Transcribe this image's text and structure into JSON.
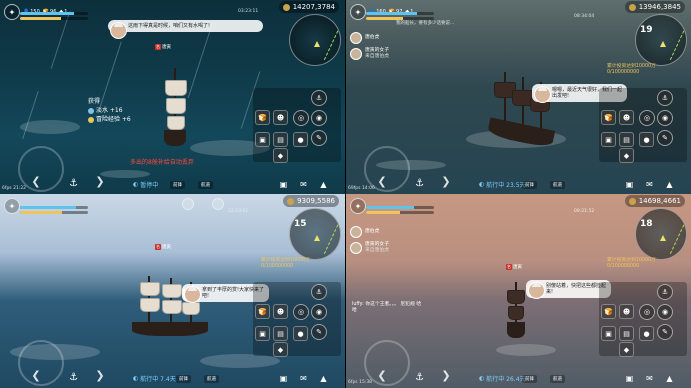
{
  "quadrants": [
    {
      "top": {
        "stat1": "150",
        "stat2": "96",
        "stat3": "1",
        "clock": "03:23:11",
        "gold": "14207,3784"
      },
      "dialog": "这雨下得真是时候，咱们又有水喝了!",
      "nametag": "唐寅",
      "gain": {
        "title": "获得",
        "item1": "淡水 +16",
        "item2": "冒险经验 +6"
      },
      "warning": "多出的8舱补给自动丢弃",
      "bottom": {
        "fps": "6fps 21:22",
        "status": "暂停中",
        "btn1": "前锋",
        "btn2": "航道"
      }
    },
    {
      "top": {
        "stat1": "160",
        "stat2": "97",
        "stat3": "1",
        "clock": "08:34:04",
        "gold": "13946,3845"
      },
      "dialog_top": "我的船长，要有多少话要说...",
      "chat": [
        {
          "name": "唐伯虎",
          "text": "..."
        },
        {
          "name": "唐寅的女子",
          "text": "来自唐伯虎"
        }
      ],
      "cargo": "累计投资达到10000万0/100000000",
      "dialog": "嗯嗯，最近天气很好，我们一起出发吧!",
      "minimap_num": "19",
      "bottom": {
        "fps": "69fps 14:06",
        "status": "航行中 23.5天",
        "btn1": "前锋",
        "btn2": "航道"
      }
    },
    {
      "top": {
        "stat1": "",
        "stat2": "",
        "stat3": "",
        "clock": "22:23:01",
        "gold": "9309,5586"
      },
      "nametag": "唐寅",
      "dialog": "拿到了丰厚的赏!大家快来了吧!",
      "minimap_num": "15",
      "cargo": "累计投资达到10000万0/100000000",
      "bottom": {
        "fps": "",
        "status": "航行中 7.4天",
        "btn1": "前锋",
        "btn2": "航道"
      }
    },
    {
      "top": {
        "stat1": "",
        "stat2": "",
        "stat3": "",
        "clock": "09:21:52",
        "gold": "14698,4661"
      },
      "chat": [
        {
          "name": "唐伯虎",
          "text": "..."
        },
        {
          "name": "唐寅的女子",
          "text": "来自唐伯虎"
        }
      ],
      "nametag": "唐寅",
      "minimap_num": "18",
      "cargo": "累计投资达到10000万0/100000000",
      "dialog": "别傻站着，快把这些都捡起来!",
      "chatline": "luffy: 你这个王者。。。 尼犯规 哈哈",
      "bottom": {
        "fps": "6fps 15:38",
        "status": "航行中 26.4天",
        "btn1": "前锋",
        "btn2": "航道"
      }
    }
  ],
  "colors": {
    "status": "#7fd0ff",
    "cargo": "#f1c45c",
    "warn": "#ff4a3a"
  }
}
